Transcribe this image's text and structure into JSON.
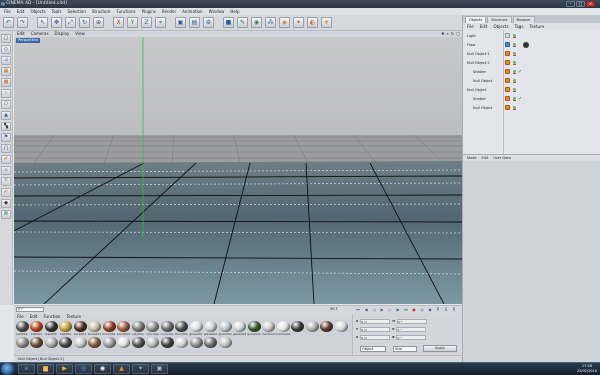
{
  "window": {
    "title": "CINEMA 4D - [Untitled.c4d]"
  },
  "menubar": [
    "File",
    "Edit",
    "Objects",
    "Tools",
    "Selection",
    "Structure",
    "Functions",
    "Plugins",
    "Render",
    "Animation",
    "Window",
    "Help"
  ],
  "viewport": {
    "menu": [
      "Edit",
      "Cameras",
      "Display",
      "View"
    ],
    "label": "Perspective",
    "nav_icons": [
      "move-icon",
      "zoom-icon",
      "rotate-icon",
      "maximize-icon"
    ]
  },
  "timeline": {
    "frame": "0 F",
    "end_frame": "90 F"
  },
  "material_manager": {
    "menu": [
      "File",
      "Edit",
      "Function",
      "Texture"
    ],
    "materials": [
      {
        "name": "ball001",
        "color": "#4a4a4a"
      },
      {
        "name": "ball002",
        "color": "#b5461c"
      },
      {
        "name": "ball003",
        "color": "#2f2f2f"
      },
      {
        "name": "ball004",
        "color": "#c2a23a"
      },
      {
        "name": "bark001",
        "color": "#4d2d1b"
      },
      {
        "name": "bone001",
        "color": "#c9bfa6"
      },
      {
        "name": "brick001",
        "color": "#8e3b24"
      },
      {
        "name": "brick002",
        "color": "#9a5a3c"
      },
      {
        "name": "clay001",
        "color": "#7a7a7a"
      },
      {
        "name": "concrete",
        "color": "#8f8f8f"
      },
      {
        "name": "concrete",
        "color": "#6a6a6a"
      },
      {
        "name": "floor001",
        "color": "#4a4a4a"
      },
      {
        "name": "glass001",
        "color": "#d9e0e6"
      },
      {
        "name": "glass002",
        "color": "#c8d3db"
      },
      {
        "name": "glass003",
        "color": "#b8c6cf"
      },
      {
        "name": "glass004",
        "color": "#d0d6da"
      },
      {
        "name": "grass001",
        "color": "#2f5a2a"
      },
      {
        "name": "marble01",
        "color": "#c7c7c7"
      },
      {
        "name": "marble02",
        "color": "#e3e3e3"
      },
      {
        "name": "",
        "color": "#3a3a3a"
      },
      {
        "name": "",
        "color": "#b0b0b0"
      },
      {
        "name": "",
        "color": "#5a3a2a"
      },
      {
        "name": "",
        "color": "#d8d8d8"
      },
      {
        "name": "",
        "color": "#8a8a8a"
      },
      {
        "name": "",
        "color": "#6b4a2a"
      },
      {
        "name": "",
        "color": "#aaaaaa"
      },
      {
        "name": "",
        "color": "#444444"
      },
      {
        "name": "",
        "color": "#c9c9c9"
      },
      {
        "name": "",
        "color": "#7a5a3a"
      },
      {
        "name": "",
        "color": "#9a9a9a"
      },
      {
        "name": "",
        "color": "#e0e0e0"
      },
      {
        "name": "",
        "color": "#505050"
      },
      {
        "name": "",
        "color": "#b9b9b9"
      },
      {
        "name": "",
        "color": "#3f3f3f"
      },
      {
        "name": "",
        "color": "#d4d4d4"
      },
      {
        "name": "",
        "color": "#8c8c8c"
      },
      {
        "name": "",
        "color": "#6a6a6a"
      },
      {
        "name": "",
        "color": "#c0c0c0"
      }
    ]
  },
  "coordinates": {
    "x": "0 m",
    "y": "0 m",
    "z": "0 m",
    "h": "0 °",
    "p": "0 °",
    "b": "0 °",
    "mode_select": "Object",
    "size_select": "Size",
    "apply_label": "Apply"
  },
  "status_text": "Null Object [Null Object 2]",
  "right_panel": {
    "tabs": [
      "Objects",
      "Structure",
      "Browser"
    ],
    "objects_menu": [
      "File",
      "Edit",
      "Objects",
      "Tags",
      "Texture"
    ],
    "objects": [
      {
        "name": "Light",
        "indent": 0,
        "icon": "light-icon"
      },
      {
        "name": "Floor",
        "indent": 0,
        "icon": "floor-icon"
      },
      {
        "name": "Null Object 1",
        "indent": 0,
        "icon": "null-icon"
      },
      {
        "name": "Null Object 2",
        "indent": 0,
        "icon": "null-icon"
      },
      {
        "name": "Shatter",
        "indent": 1,
        "icon": "shatter-icon"
      },
      {
        "name": "Null Object",
        "indent": 1,
        "icon": "null-icon"
      },
      {
        "name": "Null Object",
        "indent": 0,
        "icon": "null-icon"
      },
      {
        "name": "Shatter",
        "indent": 1,
        "icon": "shatter-icon"
      },
      {
        "name": "Null Object",
        "indent": 1,
        "icon": "null-icon"
      }
    ],
    "attributes_menu": [
      "Mode",
      "Edit",
      "User Data"
    ]
  },
  "taskbar": {
    "time": "17:28",
    "date": "25/02/2010"
  },
  "colors": {
    "accent": "#3b68a8",
    "object_icon": "#e58a24",
    "play": "#1c8a2c"
  }
}
